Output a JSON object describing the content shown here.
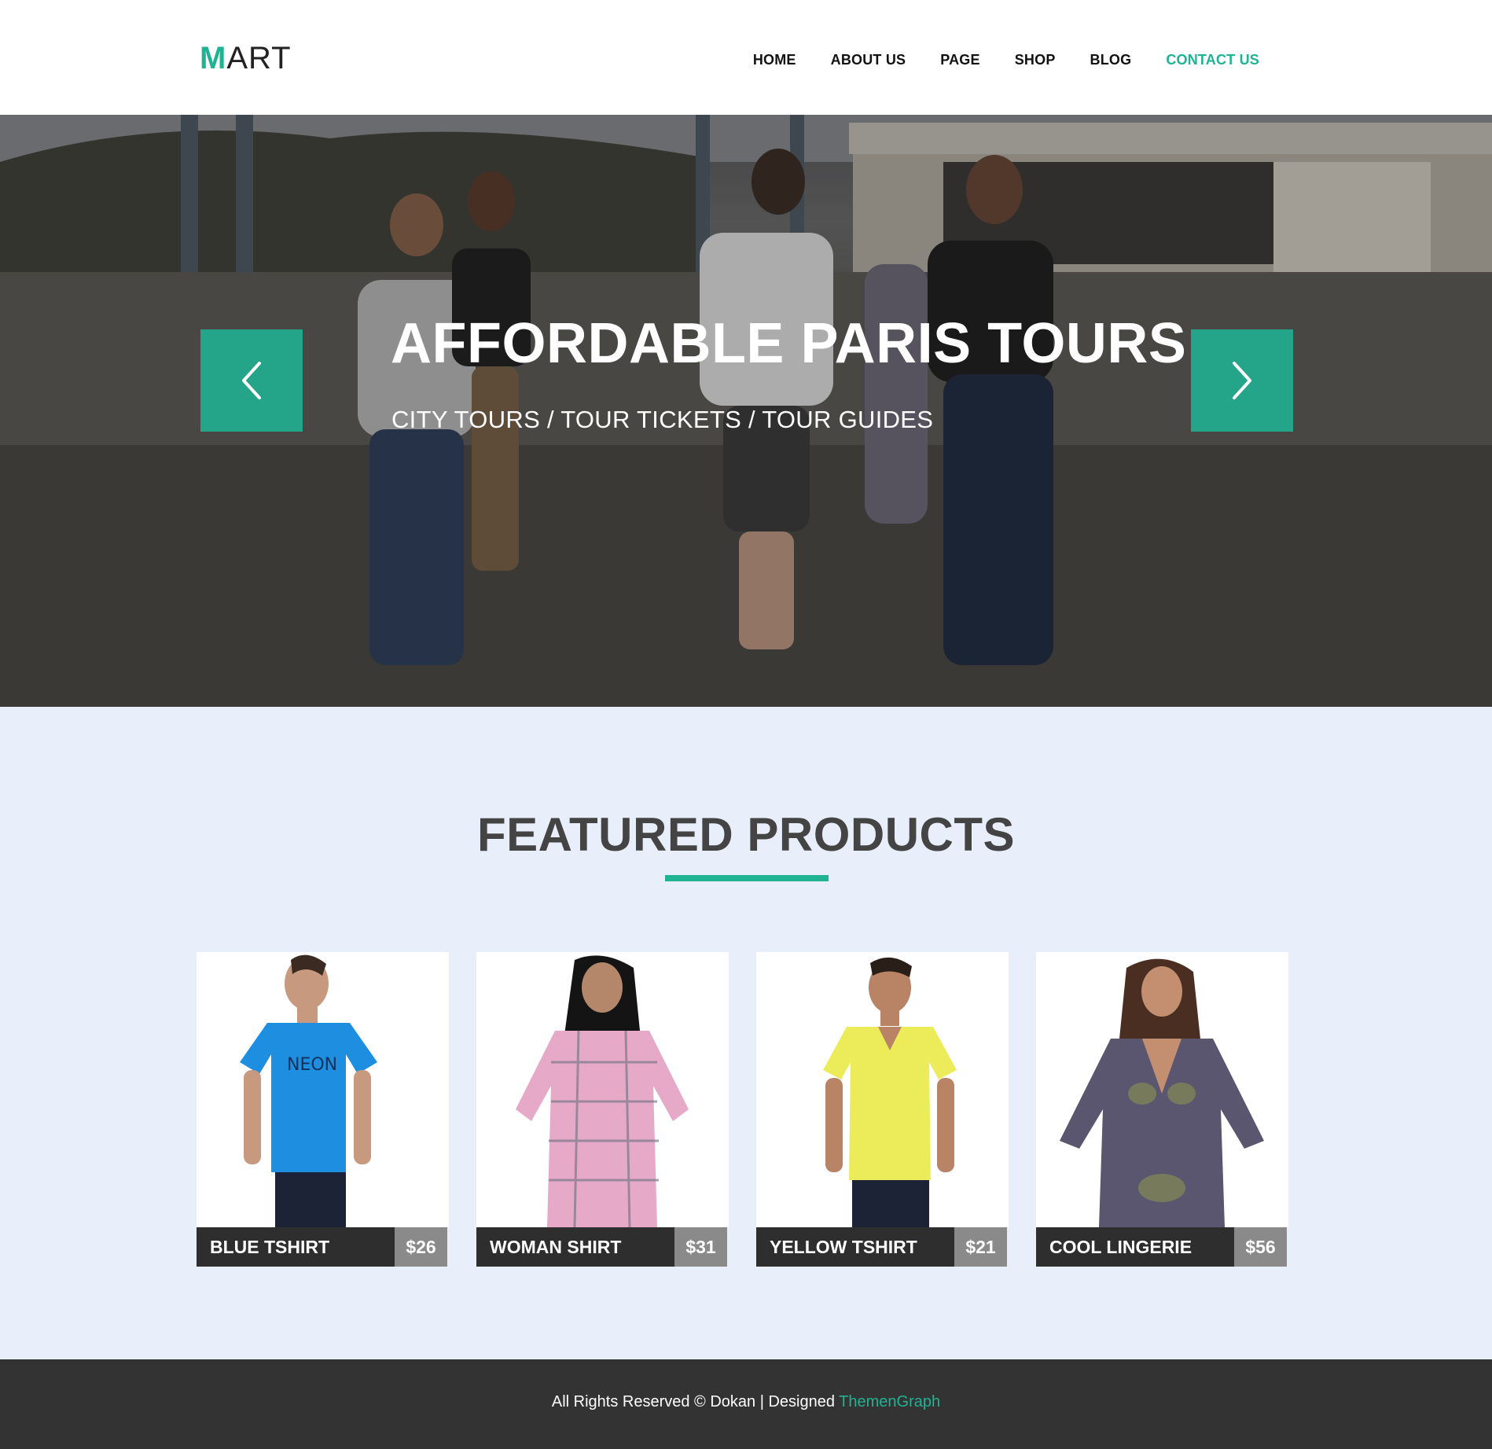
{
  "brand": {
    "first_letter": "M",
    "rest": "ART",
    "accent_color": "#1fb394"
  },
  "nav": {
    "items": [
      {
        "label": "HOME",
        "active": false
      },
      {
        "label": "ABOUT US",
        "active": false
      },
      {
        "label": "PAGE",
        "active": false
      },
      {
        "label": "SHOP",
        "active": false
      },
      {
        "label": "BLOG",
        "active": false
      },
      {
        "label": "CONTACT US",
        "active": true
      }
    ]
  },
  "hero": {
    "title": "AFFORDABLE PARIS TOURS",
    "subtitle": "CITY TOURS / TOUR TICKETS / TOUR GUIDES",
    "prev_icon": "chevron-left-icon",
    "next_icon": "chevron-right-icon"
  },
  "featured": {
    "title": "FEATURED PRODUCTS",
    "products": [
      {
        "name": "BLUE TSHIRT",
        "price": "$26",
        "garment_color": "#1e8fe0"
      },
      {
        "name": "WOMAN SHIRT",
        "price": "$31",
        "garment_color": "#e7a9c8"
      },
      {
        "name": "YELLOW TSHIRT",
        "price": "$21",
        "garment_color": "#ecec5a"
      },
      {
        "name": "COOL LINGERIE",
        "price": "$56",
        "garment_color": "#5a5670"
      }
    ]
  },
  "footer": {
    "text": "All Rights Reserved © Dokan | Designed",
    "link_text": "ThemenGraph"
  },
  "colors": {
    "accent": "#1fb394",
    "featured_bg": "#e8effb",
    "footer_bg": "#333333",
    "label_bg": "#2e2e2e",
    "price_bg": "#8a8a8a"
  }
}
